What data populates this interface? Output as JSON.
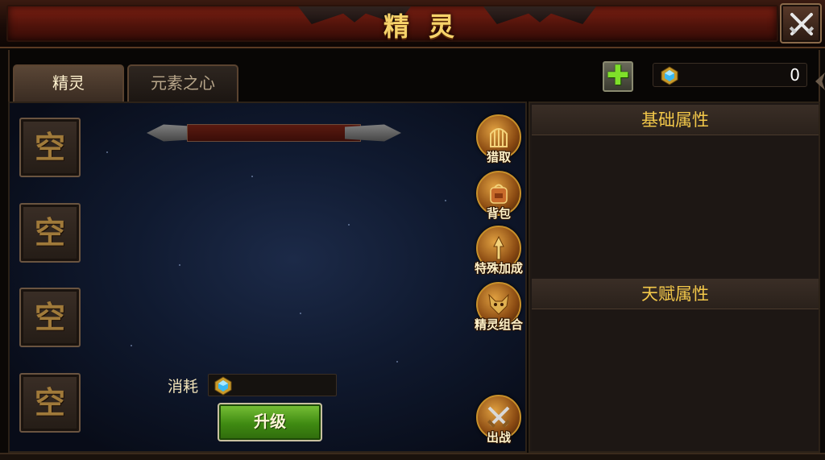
{
  "window": {
    "title": "精灵",
    "close_icon": "crossed-swords-close-icon"
  },
  "tabs": [
    {
      "label": "精灵",
      "active": true
    },
    {
      "label": "元素之心",
      "active": false
    }
  ],
  "toolbar": {
    "add_symbol": "✚",
    "currency_icon": "blue-gem-icon",
    "currency_value": "0"
  },
  "spirit_slots": [
    {
      "label": "空"
    },
    {
      "label": "空"
    },
    {
      "label": "空"
    },
    {
      "label": "空"
    }
  ],
  "side_actions": [
    {
      "label": "猎取",
      "icon": "cage-icon"
    },
    {
      "label": "背包",
      "icon": "backpack-icon"
    },
    {
      "label": "特殊加成",
      "icon": "spear-icon"
    },
    {
      "label": "精灵组合",
      "icon": "beast-head-icon"
    },
    {
      "label": "出战",
      "icon": "crossed-swords-icon"
    }
  ],
  "upgrade": {
    "cost_label": "消耗",
    "cost_icon": "blue-gem-icon",
    "cost_value": "",
    "button_label": "升级"
  },
  "attributes": {
    "basic_title": "基础属性",
    "talent_title": "天赋属性"
  },
  "colors": {
    "title_gold": "#f7d36a",
    "header_gold": "#f3c84a",
    "upgrade_green": "#3f8a12",
    "add_green": "#7fe02a"
  }
}
